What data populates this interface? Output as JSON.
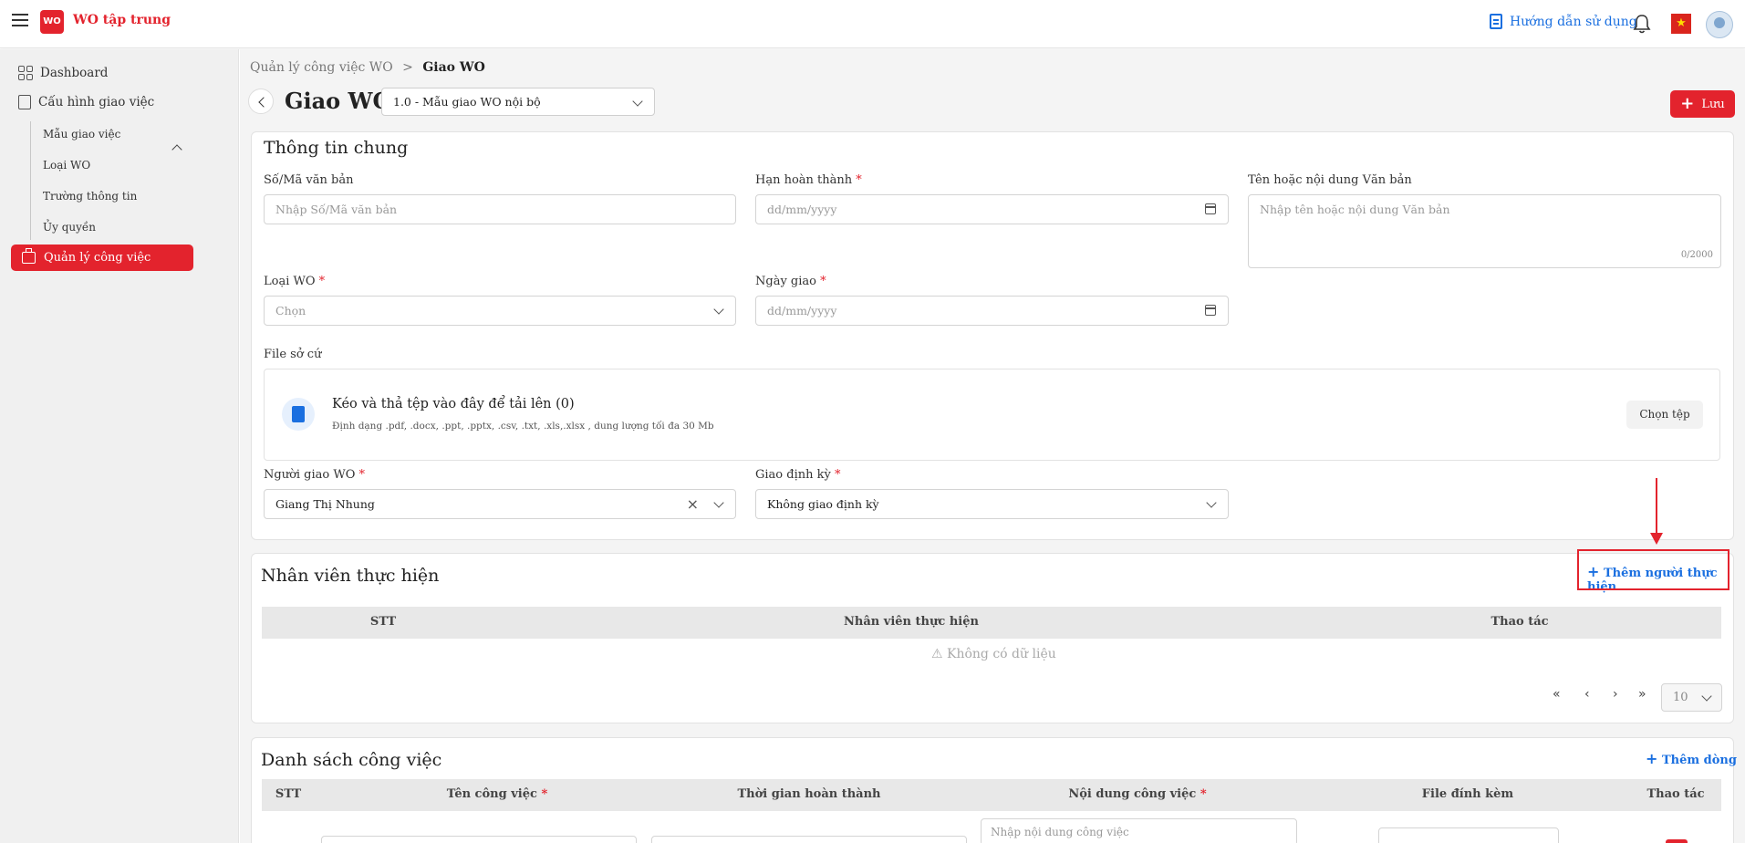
{
  "header": {
    "app_title": "WO tập trung",
    "logo_text": "WO",
    "guide_label": "Hướng dẫn sử dụng",
    "flag_symbol": "★"
  },
  "sidebar": {
    "items": [
      {
        "label": "Dashboard"
      },
      {
        "label": "Cấu hình giao việc"
      }
    ],
    "sub_items": [
      "Mẫu giao việc",
      "Loại WO",
      "Trường thông tin",
      "Ủy quyền"
    ],
    "active_item": "Quản lý công việc"
  },
  "breadcrumb": {
    "parent": "Quản lý công việc WO",
    "separator": ">",
    "current": "Giao WO"
  },
  "page": {
    "title": "Giao WO",
    "template_value": "1.0 - Mẫu giao WO nội bộ",
    "save_label": "Lưu"
  },
  "general_info": {
    "title": "Thông tin chung",
    "doc_number": {
      "label": "Số/Mã văn bản",
      "placeholder": "Nhập Số/Mã văn bản"
    },
    "deadline": {
      "label": "Hạn hoàn thành",
      "placeholder": "dd/mm/yyyy"
    },
    "doc_name": {
      "label": "Tên hoặc nội dung Văn bản",
      "placeholder": "Nhập tên hoặc nội dung Văn bản",
      "counter": "0/2000"
    },
    "wo_type": {
      "label": "Loại WO",
      "placeholder": "Chọn"
    },
    "assign_date": {
      "label": "Ngày giao",
      "placeholder": "dd/mm/yyyy"
    },
    "file_label": "File sở cứ",
    "upload": {
      "title": "Kéo và thả tệp vào đây để tải lên (0)",
      "subtitle": "Định dạng .pdf, .docx, .ppt, .pptx, .csv, .txt, .xls,.xlsx , dung lượng tối đa 30 Mb",
      "button": "Chọn tệp"
    },
    "assigner": {
      "label": "Người giao WO",
      "value": "Giang Thị Nhung"
    },
    "periodic": {
      "label": "Giao định kỳ",
      "value": "Không giao định kỳ"
    },
    "required_mark": "*"
  },
  "staff_section": {
    "title": "Nhân viên thực hiện",
    "add_label": "Thêm người thực hiện",
    "columns": [
      "STT",
      "Nhân viên thực hiện",
      "Thao tác"
    ],
    "empty_text": "⚠ Không có dữ liệu",
    "pager": {
      "first": "«",
      "prev": "‹",
      "next": "›",
      "last": "»",
      "page_size": "10"
    }
  },
  "task_section": {
    "title": "Danh sách công việc",
    "add_label": "Thêm dòng",
    "columns": [
      "STT",
      "Tên công việc",
      "Thời gian hoàn thành",
      "Nội dung công việc",
      "File đính kèm",
      "Thao tác"
    ],
    "content_placeholder": "Nhập nội dung công việc"
  },
  "colors": {
    "accent": "#e3232d",
    "link": "#1a6fe0"
  }
}
